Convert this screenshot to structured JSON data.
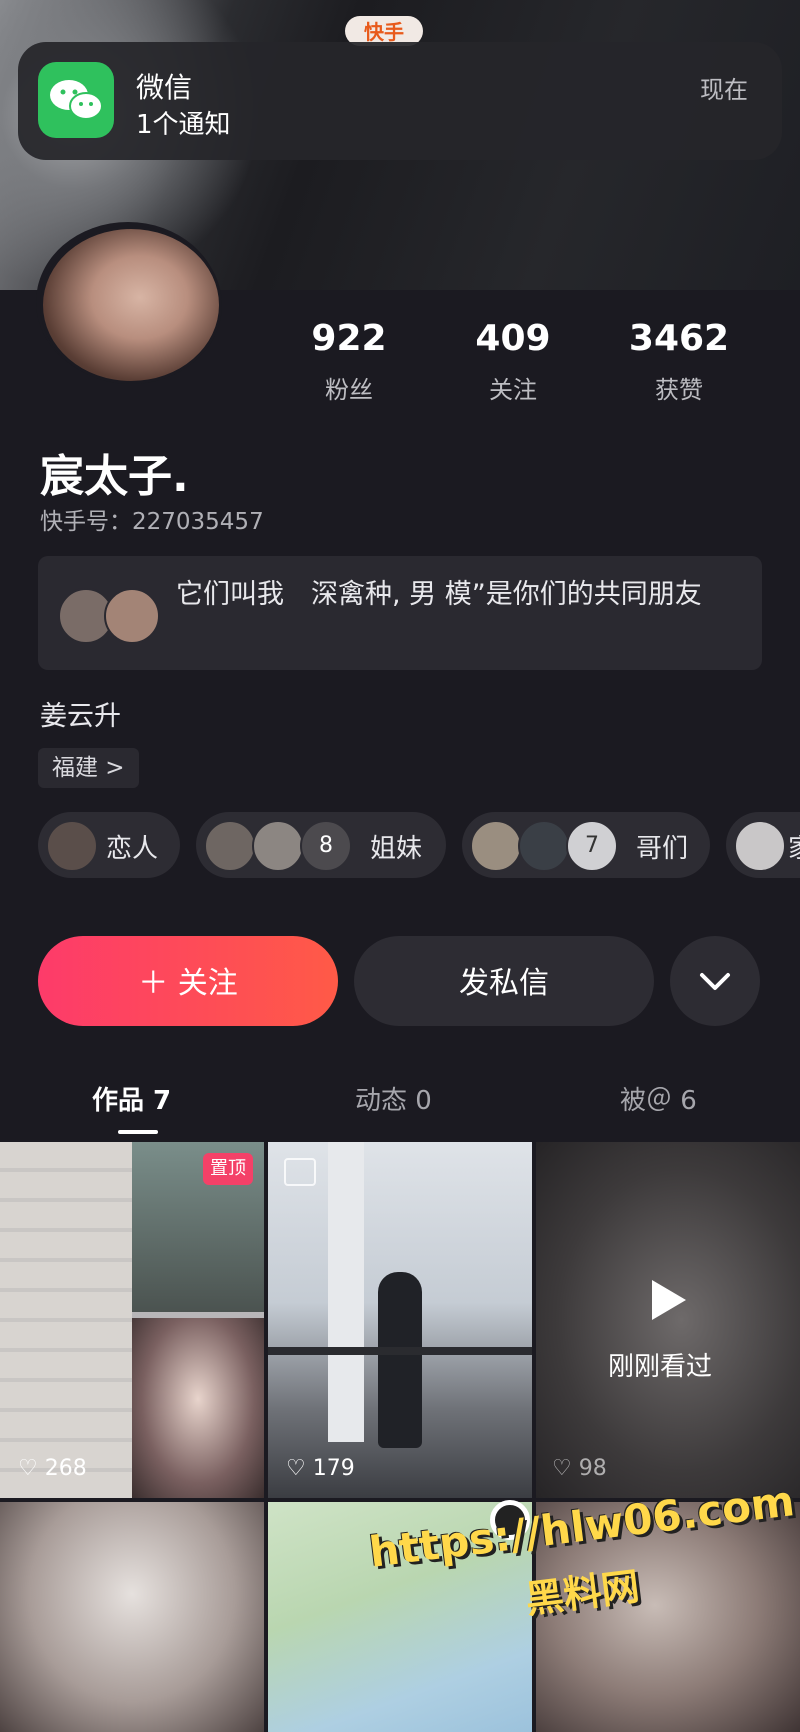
{
  "notification": {
    "app": "微信",
    "message": "1个通知",
    "time": "现在"
  },
  "topbar": {
    "app_logo": "快手"
  },
  "profile": {
    "stats": [
      {
        "value": "922",
        "label": "粉丝"
      },
      {
        "value": "409",
        "label": "关注"
      },
      {
        "value": "3462",
        "label": "获赞"
      }
    ],
    "name": "宸太子.",
    "kuaishou_id": "快手号：227035457",
    "mutual_friends": "它们叫我　深禽种, 男 模”是你们的共同朋友",
    "bio": "姜云升",
    "location": "福建 >"
  },
  "relations": [
    {
      "label": "恋人"
    },
    {
      "count": "8",
      "label": "姐妹"
    },
    {
      "count": "7",
      "label": "哥们"
    },
    {
      "label": "家"
    }
  ],
  "actions": {
    "follow": "＋ 关注",
    "message": "发私信"
  },
  "tabs": [
    {
      "label": "作品 7"
    },
    {
      "label": "动态 0"
    },
    {
      "label": "被＠ 6"
    }
  ],
  "grid": {
    "pin_label": "置顶",
    "likes": [
      "268",
      "179",
      "98"
    ],
    "recently_watched": "刚刚看过"
  },
  "watermark": {
    "url": "https://hlw06.com",
    "name": "黑料网"
  }
}
